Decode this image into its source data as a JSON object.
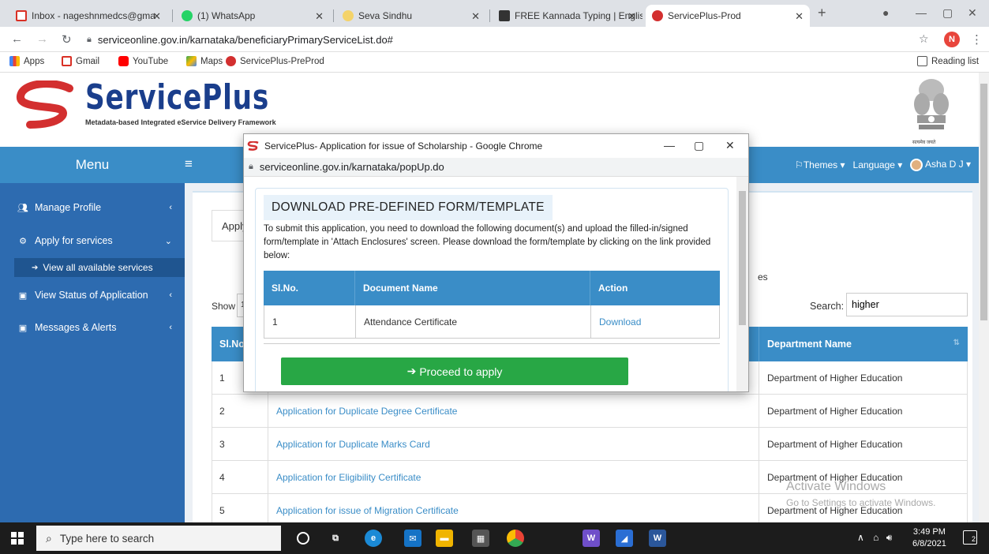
{
  "browser": {
    "tabs": [
      {
        "label": "Inbox - nageshnmedcs@gma",
        "favicon_color": "#d93025"
      },
      {
        "label": "(1) WhatsApp",
        "favicon_color": "#25d366"
      },
      {
        "label": "Seva Sindhu",
        "favicon_color": "#d4a017"
      },
      {
        "label": "FREE Kannada Typing | Englis",
        "favicon_color": "#333333"
      },
      {
        "label": "ServicePlus-Prod",
        "favicon_color": "#d32f2f"
      }
    ],
    "url": "serviceonline.gov.in/karnataka/beneficiaryPrimaryServiceList.do#",
    "profile_initial": "N",
    "bookmarks": [
      "Apps",
      "Gmail",
      "YouTube",
      "Maps",
      "ServicePlus-PreProd"
    ],
    "reading_list": "Reading list"
  },
  "header": {
    "logo_text": "ServicePlus",
    "tagline": "Metadata-based Integrated eService Delivery Framework",
    "emblem_caption": "सत्यमेव जयते"
  },
  "nav": {
    "menu_label": "Menu",
    "themes": "Themes",
    "language": "Language",
    "user": "Asha D J"
  },
  "sidebar": {
    "items": [
      {
        "label": "Manage Profile"
      },
      {
        "label": "Apply for services"
      },
      {
        "label": "View all available services"
      },
      {
        "label": "View Status of Application"
      },
      {
        "label": "Messages & Alerts"
      }
    ]
  },
  "main": {
    "tab_label": "Apply",
    "partial_text": "es",
    "show_label": "Show",
    "show_value": "1",
    "search_label": "Search:",
    "search_value": "higher",
    "columns": [
      "Sl.No.",
      "Department Name"
    ],
    "rows": [
      {
        "no": "1",
        "service": "",
        "dept": "Department of Higher Education"
      },
      {
        "no": "2",
        "service": "Application for Duplicate Degree Certificate",
        "dept": "Department of Higher Education"
      },
      {
        "no": "3",
        "service": "Application for Duplicate Marks Card",
        "dept": "Department of Higher Education"
      },
      {
        "no": "4",
        "service": "Application for Eligibility Certificate",
        "dept": "Department of Higher Education"
      },
      {
        "no": "5",
        "service": "Application for issue of Migration Certificate",
        "dept": "Department of Higher Education"
      }
    ]
  },
  "watermark": {
    "line1": "Activate Windows",
    "line2": "Go to Settings to activate Windows."
  },
  "popup": {
    "title": "ServicePlus- Application for issue of Scholarship - Google Chrome",
    "url": "serviceonline.gov.in/karnataka/popUp.do",
    "heading": "DOWNLOAD PRE-DEFINED FORM/TEMPLATE",
    "description": "To submit this application, you need to download the following document(s) and upload the filled-in/signed form/template in 'Attach Enclosures' screen. Please download the form/template by clicking on the link provided below:",
    "columns": [
      "Sl.No.",
      "Document Name",
      "Action"
    ],
    "rows": [
      {
        "no": "1",
        "document": "Attendance Certificate",
        "action": "Download"
      }
    ],
    "proceed_label": "Proceed to apply"
  },
  "taskbar": {
    "search_placeholder": "Type here to search",
    "time": "3:49 PM",
    "date": "6/8/2021",
    "notification_count": "2"
  },
  "colors": {
    "primary_blue": "#3a8dc7",
    "sidebar_blue": "#2d6bb0",
    "proceed_green": "#28a745",
    "logo_red": "#d32f2f",
    "logo_blue": "#1a3e8c"
  }
}
